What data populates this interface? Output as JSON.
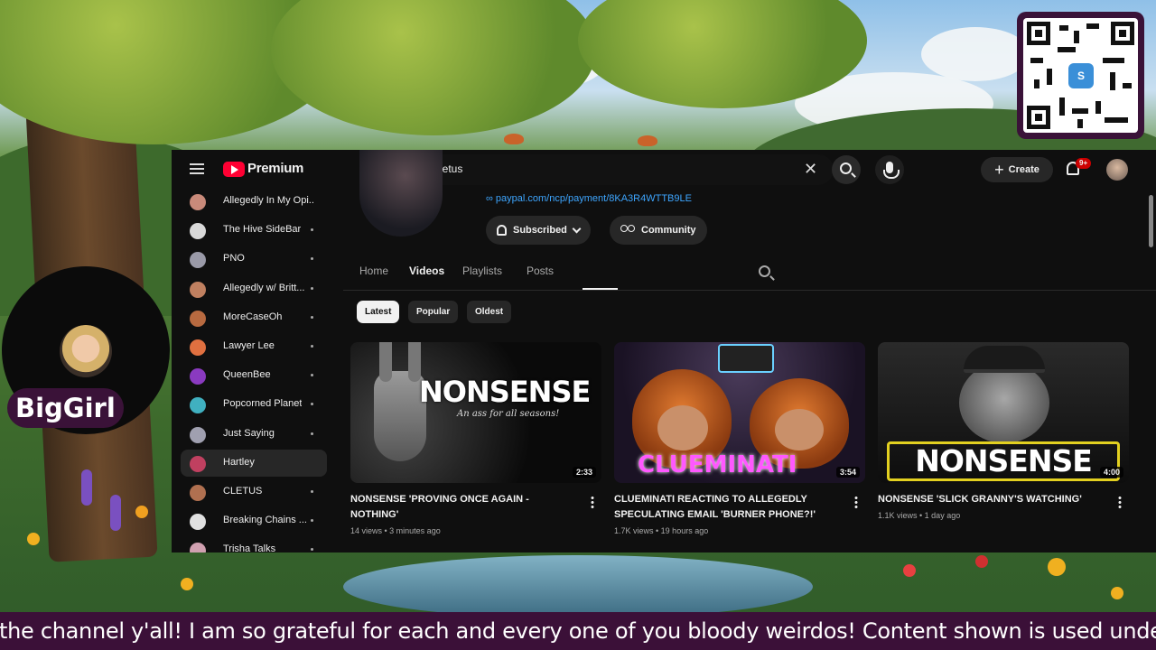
{
  "stream": {
    "streamer_name": "BigGirl",
    "ticker_text": "the channel y'all! I am so grateful for each and every one of you bloody weirdos! Content shown is used unde",
    "qr_logo_text": "S"
  },
  "youtube": {
    "brand": "Premium",
    "search": {
      "value": "realcletus"
    },
    "create_label": "Create",
    "notification_badge": "9+",
    "channel": {
      "link_text": "paypal.com/ncp/payment/8KA3R4WTTB9LE",
      "subscribed_label": "Subscribed",
      "community_label": "Community"
    },
    "tabs": [
      {
        "label": "Home",
        "active": false
      },
      {
        "label": "Videos",
        "active": true
      },
      {
        "label": "Playlists",
        "active": false
      },
      {
        "label": "Posts",
        "active": false
      }
    ],
    "chips": [
      {
        "label": "Latest",
        "active": true
      },
      {
        "label": "Popular",
        "active": false
      },
      {
        "label": "Oldest",
        "active": false
      }
    ],
    "sidebar": [
      {
        "label": "Allegedly In My Opi...",
        "color": "#c98a7a",
        "active": false,
        "dot": false
      },
      {
        "label": "The Hive SideBar",
        "color": "#d9d9d9",
        "active": false,
        "dot": true
      },
      {
        "label": "PNO",
        "color": "#9a9aa8",
        "active": false,
        "dot": true
      },
      {
        "label": "Allegedly w/ Britt...",
        "color": "#c08060",
        "active": false,
        "dot": true
      },
      {
        "label": "MoreCaseOh",
        "color": "#b86a40",
        "active": false,
        "dot": true
      },
      {
        "label": "Lawyer Lee",
        "color": "#e07040",
        "active": false,
        "dot": true
      },
      {
        "label": "QueenBee",
        "color": "#8a3ac0",
        "active": false,
        "dot": true
      },
      {
        "label": "Popcorned Planet",
        "color": "#40b0c0",
        "active": false,
        "dot": true
      },
      {
        "label": "Just Saying",
        "color": "#a0a0b0",
        "active": false,
        "dot": true
      },
      {
        "label": "Hartley",
        "color": "#c04060",
        "active": true,
        "dot": false
      },
      {
        "label": "CLETUS",
        "color": "#b07050",
        "active": false,
        "dot": true
      },
      {
        "label": "Breaking Chains ...",
        "color": "#e0e0e0",
        "active": false,
        "dot": true
      },
      {
        "label": "Trisha Talks",
        "color": "#d0a0b0",
        "active": false,
        "dot": true
      }
    ],
    "videos": [
      {
        "title": "NONSENSE 'PROVING ONCE AGAIN - NOTHING'",
        "meta": "14 views • 3 minutes ago",
        "duration": "2:33",
        "thumb_text": "NONSENSE",
        "thumb_subtext": "An ass for all seasons!"
      },
      {
        "title": "CLUEMINATI REACTING TO ALLEGEDLY SPECULATING EMAIL 'BURNER PHONE?!'",
        "meta": "1.7K views • 19 hours ago",
        "duration": "3:54",
        "thumb_text": "CLUEMINATI",
        "thumb_subtext": ""
      },
      {
        "title": "NONSENSE 'SLICK GRANNY'S WATCHING'",
        "meta": "1.1K views • 1 day ago",
        "duration": "4:00",
        "thumb_text": "NONSENSE",
        "thumb_subtext": ""
      }
    ]
  }
}
